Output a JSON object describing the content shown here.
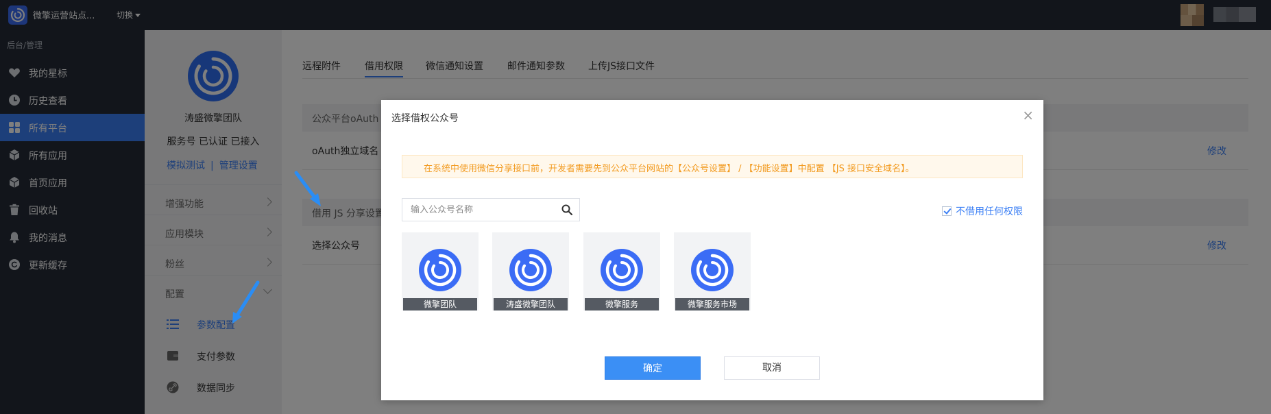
{
  "topbar": {
    "site_name": "微擎运营站点...",
    "switch_label": "切换"
  },
  "sidebar": {
    "heading": "后台/管理",
    "items": [
      {
        "label": "我的星标",
        "icon": "heart-icon"
      },
      {
        "label": "历史查看",
        "icon": "clock-icon"
      },
      {
        "label": "所有平台",
        "icon": "grid-icon",
        "active": true
      },
      {
        "label": "所有应用",
        "icon": "cube-icon"
      },
      {
        "label": "首页应用",
        "icon": "cube-icon"
      },
      {
        "label": "回收站",
        "icon": "trash-icon"
      },
      {
        "label": "我的消息",
        "icon": "bell-icon"
      },
      {
        "label": "更新缓存",
        "icon": "refresh-icon"
      }
    ]
  },
  "subside": {
    "account_name": "涛盛微擎团队",
    "status": "服务号 已认证 已接入",
    "link_test": "模拟测试",
    "link_sep": "|",
    "link_manage": "管理设置",
    "items": [
      {
        "label": "增强功能"
      },
      {
        "label": "应用模块"
      },
      {
        "label": "粉丝"
      },
      {
        "label": "配置"
      }
    ],
    "children": [
      {
        "label": "参数配置",
        "active": true
      },
      {
        "label": "支付参数"
      },
      {
        "label": "数据同步"
      }
    ]
  },
  "main": {
    "tabs": [
      {
        "label": "远程附件"
      },
      {
        "label": "借用权限",
        "active": true
      },
      {
        "label": "微信通知设置"
      },
      {
        "label": "邮件通知参数"
      },
      {
        "label": "上传JS接口文件"
      }
    ],
    "section1": "公众平台oAuth",
    "row1_label": "oAuth独立域名",
    "row1_action": "修改",
    "section2": "借用 JS 分享设置",
    "row2_label": "选择公众号",
    "row2_action": "修改"
  },
  "modal": {
    "title": "选择借权公众号",
    "close": "×",
    "notice": "在系统中使用微信分享接口前，开发者需要先到公众平台网站的【公众号设置】 / 【功能设置】中配置 【JS 接口安全域名】。",
    "search_placeholder": "输入公众号名称",
    "no_borrow_label": "不借用任何权限",
    "no_borrow_checked": true,
    "accounts": [
      {
        "name": "微擎团队",
        "selected": false
      },
      {
        "name": "涛盛微擎团队",
        "selected": false
      },
      {
        "name": "微擎服务",
        "selected": false
      },
      {
        "name": "微擎服务市场",
        "selected": false
      }
    ],
    "confirm_label": "确定",
    "cancel_label": "取消"
  },
  "colors": {
    "topbar_bg": "#252b36",
    "accent": "#3b7ff5",
    "notice_text": "#f29a1f"
  }
}
